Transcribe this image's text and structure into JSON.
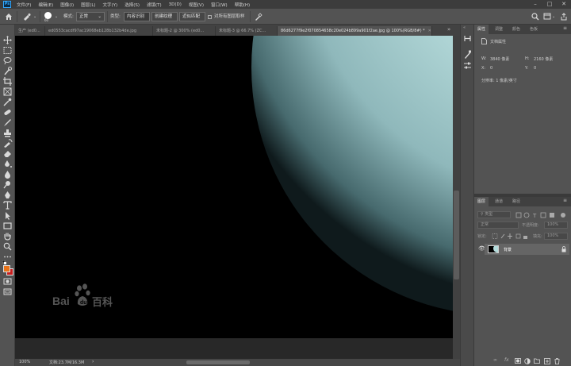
{
  "menubar": {
    "app_logo": "Ps",
    "items": [
      "文件(F)",
      "编辑(E)",
      "图像(I)",
      "图层(L)",
      "文字(Y)",
      "选择(S)",
      "滤镜(T)",
      "3D(D)",
      "视图(V)",
      "窗口(W)",
      "帮助(H)"
    ]
  },
  "options": {
    "brush_size": "60",
    "mode_label": "模式:",
    "mode_value": "正常",
    "type_label": "类型:",
    "btn_content_aware": "内容识别",
    "btn_create_texture": "创建纹理",
    "btn_proximity": "近似匹配",
    "sample_all_layers": "对所有图层取样"
  },
  "tabs": [
    {
      "label": "生产 (ed0...",
      "active": false
    },
    {
      "label": "ed0553cacdf97ac19068eb128b132b4de.jpg",
      "active": false
    },
    {
      "label": "未标题-2 @ 300% (ed0...",
      "active": false
    },
    {
      "label": "未标题-3 @ 66.7% (ZC...",
      "active": false
    },
    {
      "label": "86d6277f9e2f070854658c20e024b899a901f2ae.jpg @ 100%(RGB/8#) *",
      "active": true
    }
  ],
  "watermark": {
    "text_left": "Bai",
    "text_right": "百科"
  },
  "status": {
    "zoom": "100%",
    "doc_size": "文档:23.7M/16.3M"
  },
  "properties_panel": {
    "tabs": [
      "属性",
      "调整",
      "颜色",
      "色板"
    ],
    "doc_title": "文档属性",
    "w_label": "W:",
    "w_value": "3840 像素",
    "h_label": "H:",
    "h_value": "2160 像素",
    "x_label": "X:",
    "x_value": "0",
    "y_label": "Y:",
    "y_value": "0",
    "resolution": "分辨率: 1 像素/英寸"
  },
  "layers_panel": {
    "tabs": [
      "图层",
      "通道",
      "路径"
    ],
    "filter_placeholder": "类型",
    "blend_mode": "正常",
    "opacity_label": "不透明度:",
    "opacity_value": "100%",
    "lock_label": "锁定:",
    "fill_label": "填充:",
    "fill_value": "100%",
    "layers": [
      {
        "name": "背景",
        "visible": true,
        "locked": true
      }
    ]
  },
  "colors": {
    "foreground": "#e8731a",
    "background": "#c81e1e",
    "planet": "#b4dcdc"
  }
}
